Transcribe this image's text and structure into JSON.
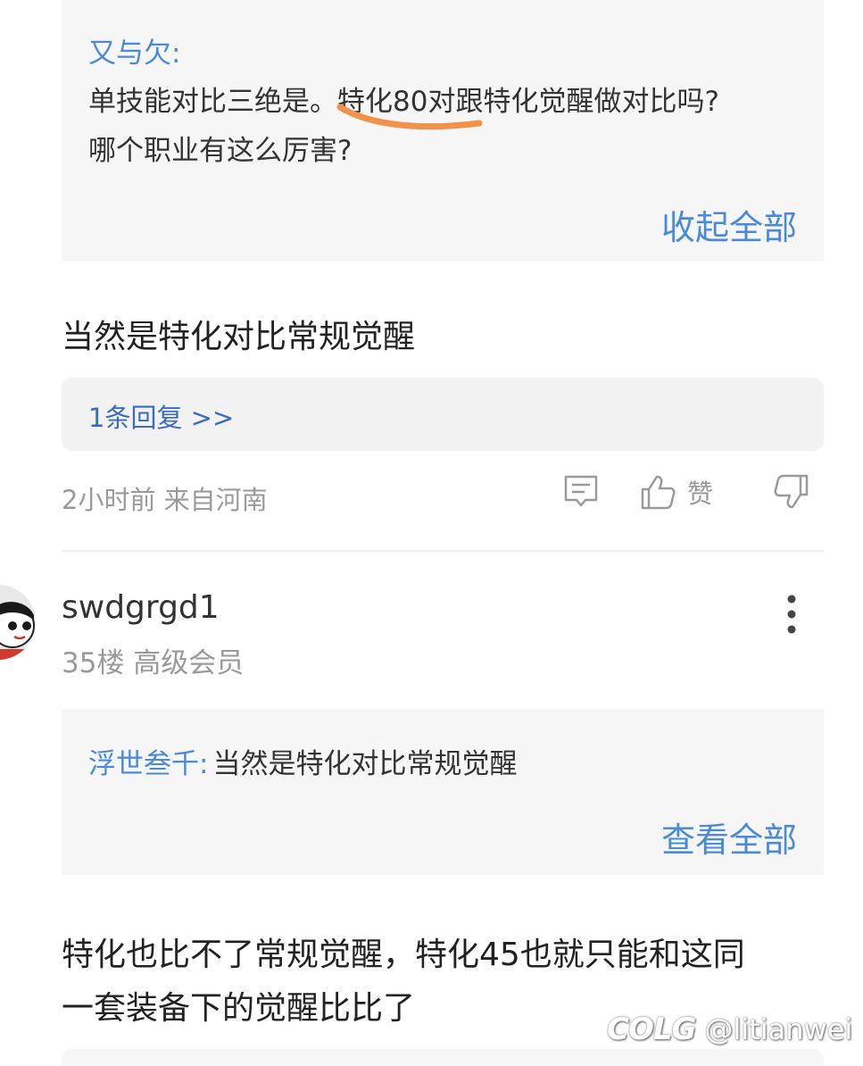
{
  "quote_top": {
    "author": "又与欠:",
    "line1": "单技能对比三绝是。特化80对跟特化觉醒做对比吗?",
    "line2": "哪个职业有这么厉害?",
    "collapse_label": "收起全部"
  },
  "comment_1": {
    "body": "当然是特化对比常规觉醒",
    "reply_link": "1条回复 >>",
    "meta": "2小时前 来自河南",
    "like_label": "赞"
  },
  "comment_2": {
    "username": "swdgrgd1",
    "floor_info": "35楼 高级会员",
    "quote_author": "浮世叁千:",
    "quote_text": "当然是特化对比常规觉醒",
    "viewall_label": "查看全部",
    "body_line1": "特化也比不了常规觉醒，特化45也就只能和这同",
    "body_line2": "一套装备下的觉醒比比了"
  },
  "watermark": {
    "logo": "COLG",
    "user": "@litianwei"
  },
  "colors": {
    "link_blue": "#4a8ad8",
    "annotation_orange": "#f0924a",
    "quote_bg": "#f6f6f6"
  }
}
